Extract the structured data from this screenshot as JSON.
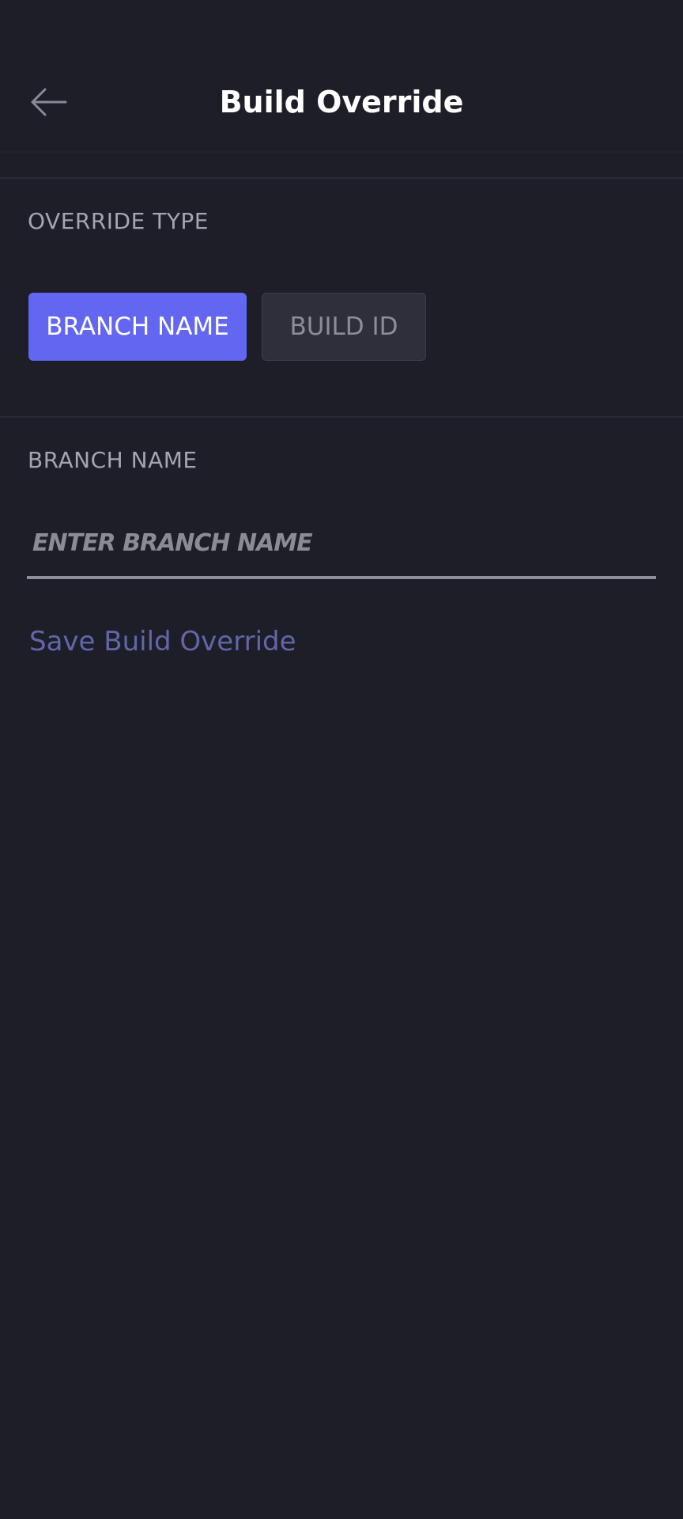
{
  "header": {
    "title": "Build Override",
    "back_icon": "arrow-left-icon"
  },
  "override_type": {
    "label": "OVERRIDE TYPE",
    "options": [
      {
        "label": "BRANCH NAME",
        "selected": true
      },
      {
        "label": "BUILD ID",
        "selected": false
      }
    ]
  },
  "branch": {
    "label": "BRANCH NAME",
    "placeholder": "ENTER BRANCH NAME",
    "value": ""
  },
  "actions": {
    "save_label": "Save Build Override"
  },
  "colors": {
    "background": "#1e1e28",
    "accent": "#6366f1",
    "inactive_button": "#2f2f3b",
    "save_link": "#6266a8",
    "label_gray": "#a4a4b2"
  }
}
